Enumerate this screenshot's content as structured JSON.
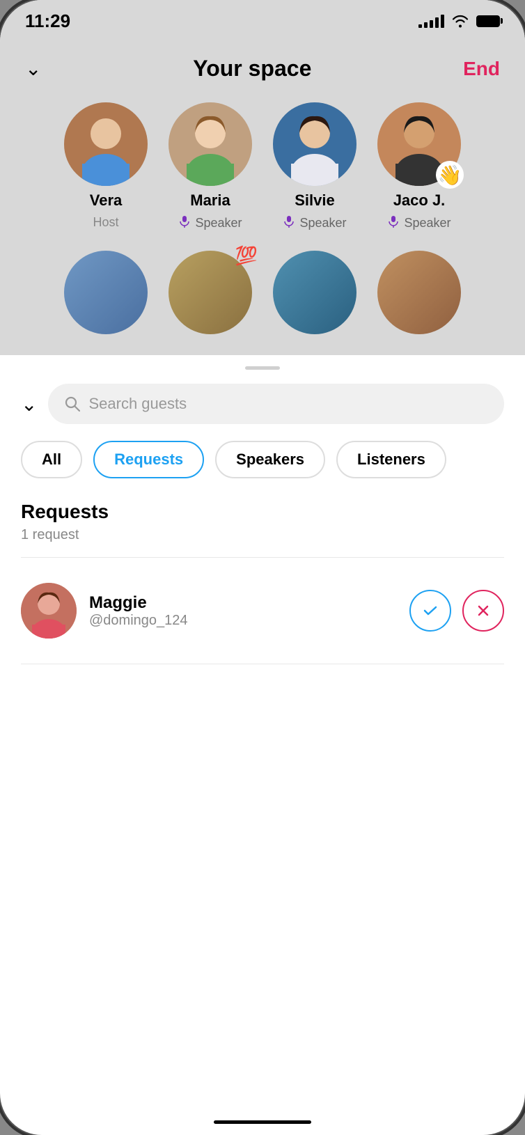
{
  "statusBar": {
    "time": "11:29",
    "signalBars": [
      4,
      7,
      10,
      14,
      17
    ],
    "battery": "full"
  },
  "header": {
    "title": "Your space",
    "endLabel": "End",
    "collapseIcon": "chevron-down"
  },
  "speakers": [
    {
      "name": "Vera",
      "role": "Host",
      "isHost": true,
      "hasMic": false,
      "hasWave": false,
      "color1": "#8B6355",
      "color2": "#C08870"
    },
    {
      "name": "Maria",
      "role": "Speaker",
      "isHost": false,
      "hasMic": true,
      "hasWave": false,
      "color1": "#A0856A",
      "color2": "#C9A882"
    },
    {
      "name": "Silvie",
      "role": "Speaker",
      "isHost": false,
      "hasMic": true,
      "hasWave": false,
      "color1": "#5B8EC4",
      "color2": "#3A6EA0"
    },
    {
      "name": "Jaco J.",
      "role": "Speaker",
      "isHost": false,
      "hasMic": true,
      "hasWave": true,
      "color1": "#C4875B",
      "color2": "#A06040"
    }
  ],
  "bottomSheet": {
    "searchPlaceholder": "Search guests",
    "collapseIcon": "chevron-down"
  },
  "filterTabs": [
    {
      "label": "All",
      "active": false
    },
    {
      "label": "Requests",
      "active": true
    },
    {
      "label": "Speakers",
      "active": false
    },
    {
      "label": "Listeners",
      "active": false
    }
  ],
  "requestsSection": {
    "title": "Requests",
    "countLabel": "1 request"
  },
  "requests": [
    {
      "name": "Maggie",
      "handle": "@domingo_124",
      "avatarColor1": "#D4927A",
      "avatarColor2": "#B06A52"
    }
  ],
  "actions": {
    "acceptIcon": "✓",
    "rejectIcon": "✕"
  }
}
